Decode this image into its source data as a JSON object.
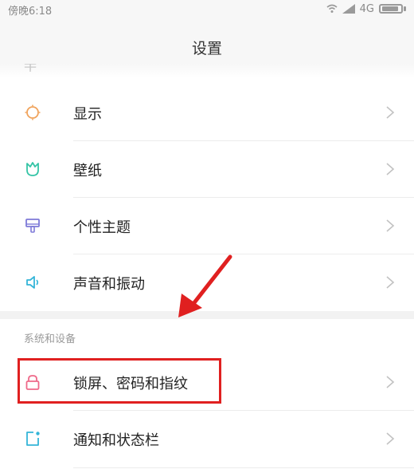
{
  "status_bar": {
    "time": "傍晚6:18",
    "network": "4G",
    "icons": [
      "wifi-icon",
      "signal-icon",
      "battery-icon"
    ]
  },
  "header": {
    "title": "设置"
  },
  "items": [
    {
      "label": "显示",
      "icon": "sun-icon",
      "icon_color": "#f0a35c"
    },
    {
      "label": "壁纸",
      "icon": "tulip-icon",
      "icon_color": "#34c4a6"
    },
    {
      "label": "个性主题",
      "icon": "brush-icon",
      "icon_color": "#7e7ad8"
    },
    {
      "label": "声音和振动",
      "icon": "speaker-icon",
      "icon_color": "#34b5d8"
    }
  ],
  "section": {
    "title": "系统和设备"
  },
  "system_items": [
    {
      "label": "锁屏、密码和指纹",
      "icon": "lock-icon",
      "icon_color": "#ef6a8a"
    },
    {
      "label": "通知和状态栏",
      "icon": "notification-icon",
      "icon_color": "#34b5d8"
    }
  ],
  "annotation": {
    "highlight_color": "#e02020",
    "arrow_color": "#e02020"
  }
}
